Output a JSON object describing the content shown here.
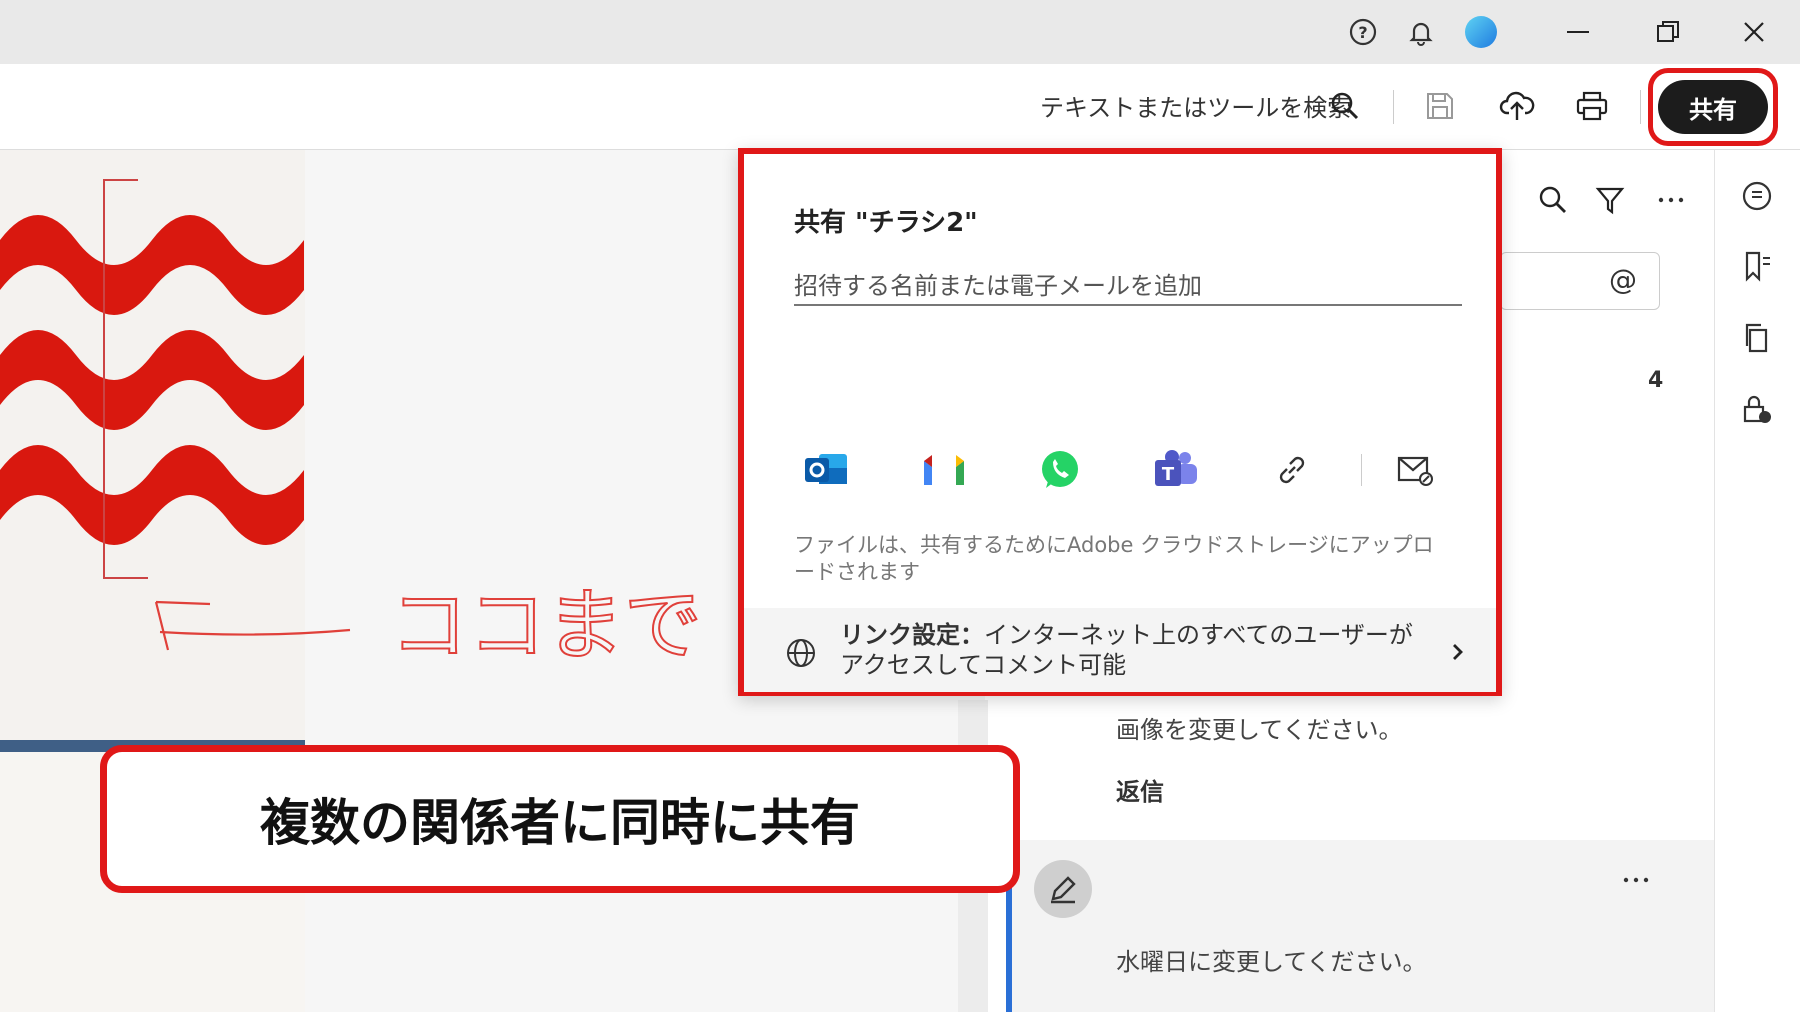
{
  "titlebar": {
    "help_icon": "help-icon",
    "bell_icon": "bell-icon",
    "profile_icon": "profile-icon",
    "minimize_icon": "minimize-icon",
    "restore_icon": "restore-icon",
    "close_icon": "close-icon"
  },
  "toolbar": {
    "search_text": "テキストまたはツールを検索",
    "share_label": "共有",
    "icons": [
      "search-icon",
      "save-icon",
      "cloud-upload-icon",
      "print-icon"
    ]
  },
  "share_popup": {
    "title": "共有 \"チラシ2\"",
    "input_placeholder": "招待する名前または電子メールを追加",
    "apps": [
      "outlook-icon",
      "gmail-icon",
      "whatsapp-icon",
      "teams-icon",
      "link-icon",
      "mail-icon"
    ],
    "note": "ファイルは、共有するためにAdobe クラウドストレージにアップロードされます",
    "link_settings_label": "リンク設定：",
    "link_settings_text": "インターネット上のすべてのユーザーがアクセスしてコメント可能"
  },
  "callout": {
    "text": "複数の関係者に同時に共有"
  },
  "document": {
    "handwritten": "ココまで"
  },
  "comments_panel": {
    "page_number": "4",
    "comment1_text": "画像を変更してください。",
    "reply_label": "返信",
    "comment2_text": "水曜日に変更してください。"
  },
  "colors": {
    "highlight_red": "#e01818",
    "share_button_bg": "#1c1c1c",
    "wave_red": "#d9180f"
  }
}
